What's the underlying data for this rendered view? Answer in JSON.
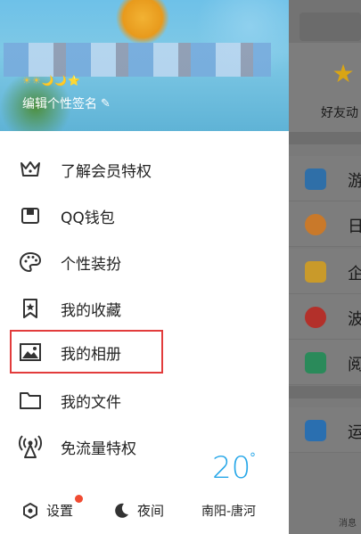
{
  "header": {
    "badges": "☀☀🌙🌙⭐",
    "signature": "编辑个性签名"
  },
  "menu": [
    {
      "label": "了解会员特权",
      "icon": "crown-icon"
    },
    {
      "label": "QQ钱包",
      "icon": "wallet-icon"
    },
    {
      "label": "个性装扮",
      "icon": "palette-icon"
    },
    {
      "label": "我的收藏",
      "icon": "bookmark-star-icon"
    },
    {
      "label": "我的相册",
      "icon": "photo-icon"
    },
    {
      "label": "我的文件",
      "icon": "folder-icon"
    },
    {
      "label": "免流量特权",
      "icon": "signal-tower-icon"
    }
  ],
  "footer": {
    "settings": "设置",
    "night": "夜间",
    "temperature": "20",
    "degree": "°",
    "city": "南阳-唐河"
  },
  "background": {
    "feature_label": "好友动",
    "rows": [
      {
        "text": "游",
        "color": "#2f6fa8"
      },
      {
        "text": "日",
        "color": "#c9792a"
      },
      {
        "text": "企",
        "color": "#c99a2a"
      },
      {
        "text": "波",
        "color": "#b3302a"
      },
      {
        "text": "阅",
        "color": "#2a8a5a"
      },
      {
        "text": "运",
        "color": "#2a6fb0"
      }
    ],
    "message_label": "消息"
  }
}
